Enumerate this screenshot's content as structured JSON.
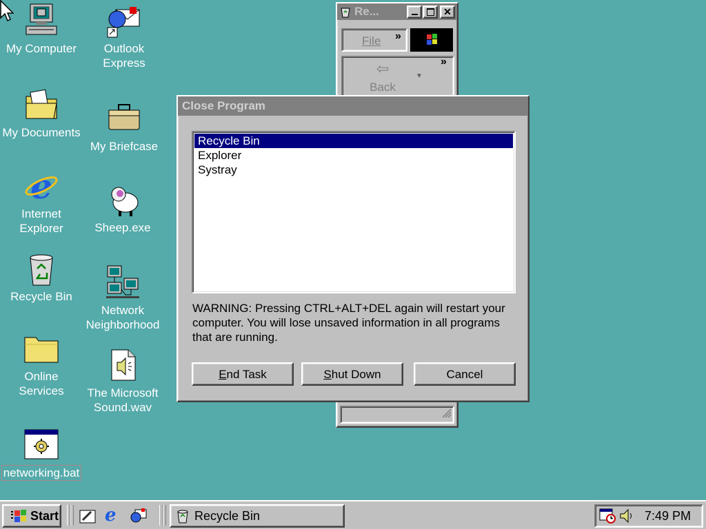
{
  "desktop": {
    "icons": [
      {
        "label": "My Computer"
      },
      {
        "label": "Outlook\nExpress"
      },
      {
        "label": "My Documents"
      },
      {
        "label": "My Briefcase"
      },
      {
        "label": "Internet\nExplorer"
      },
      {
        "label": "Sheep.exe"
      },
      {
        "label": "Recycle Bin"
      },
      {
        "label": "Network\nNeighborhood"
      },
      {
        "label": "Online\nServices"
      },
      {
        "label": "The Microsoft\nSound.wav"
      },
      {
        "label": "networking.bat"
      }
    ]
  },
  "bg_window": {
    "title": "Re...",
    "menu_file": "File",
    "back_label": "Back",
    "chevron": "»"
  },
  "dialog": {
    "title": "Close Program",
    "programs": [
      "Recycle Bin",
      "Explorer",
      "Systray"
    ],
    "selected_index": 0,
    "warning": "WARNING: Pressing CTRL+ALT+DEL again will restart your computer. You will lose unsaved information in all programs that are running.",
    "end_task": {
      "mnemonic": "E",
      "rest": "nd Task"
    },
    "shut_down": {
      "mnemonic": "S",
      "rest": "hut Down"
    },
    "cancel": "Cancel"
  },
  "taskbar": {
    "start_label": "Start",
    "task_label": "Recycle Bin",
    "clock": "7:49 PM"
  },
  "colors": {
    "desktop": "#55aaaa",
    "selection": "#000080",
    "inactive_title": "#808080"
  }
}
